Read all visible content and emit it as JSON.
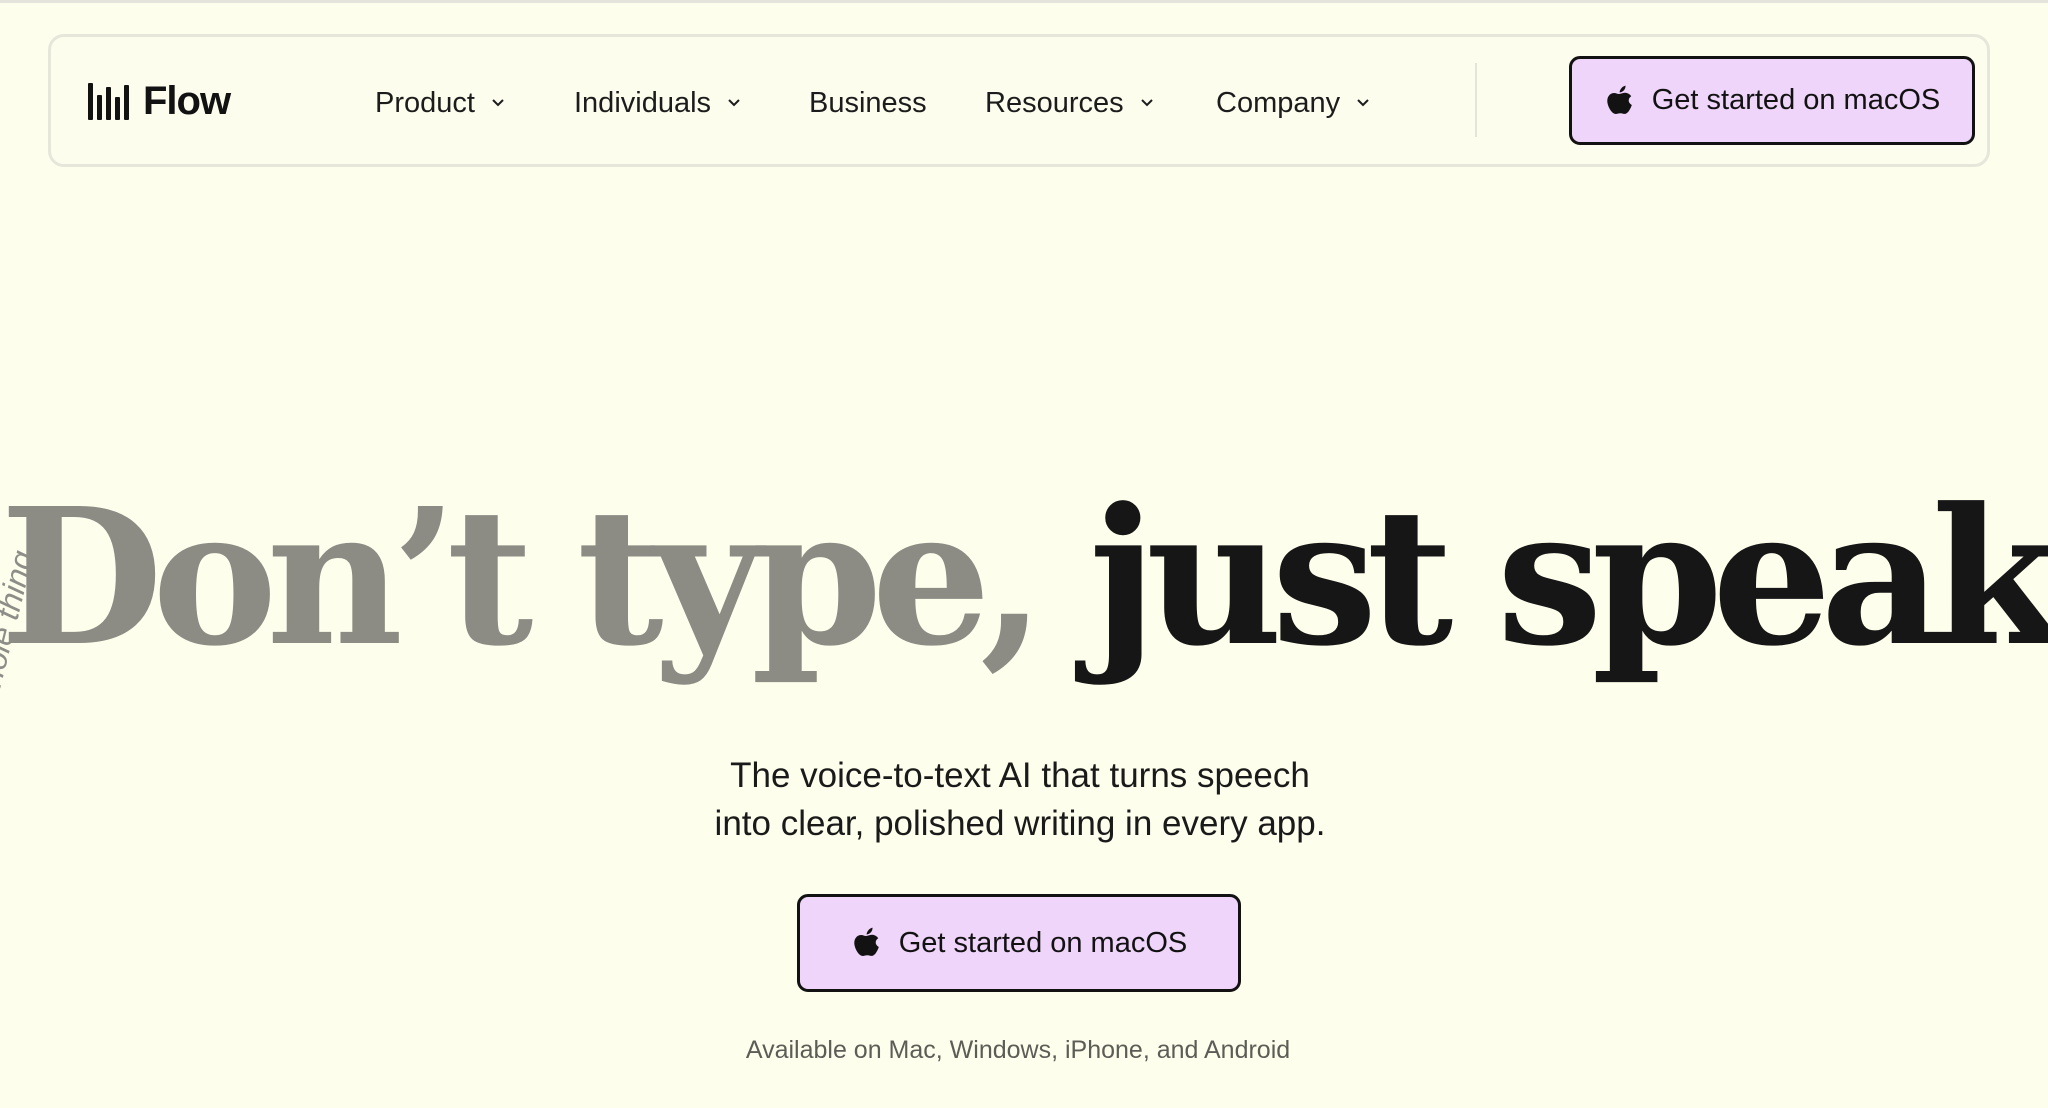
{
  "brand": {
    "name": "Flow",
    "icon": "waveform-bars-icon"
  },
  "nav": {
    "items": [
      {
        "label": "Product",
        "has_dropdown": true
      },
      {
        "label": "Individuals",
        "has_dropdown": true
      },
      {
        "label": "Business",
        "has_dropdown": false
      },
      {
        "label": "Resources",
        "has_dropdown": true
      },
      {
        "label": "Company",
        "has_dropdown": true
      }
    ],
    "cta_label": "Get started on macOS"
  },
  "hero": {
    "headline_part1": "Don’t type, ",
    "headline_part2": "just speak",
    "subtitle_line1": "The voice-to-text AI that turns speech",
    "subtitle_line2": "into clear, polished writing in every app.",
    "cta_label": "Get started on macOS",
    "availability": "Available on Mac, Windows, iPhone, and Android",
    "side_text": "e whole thing"
  },
  "colors": {
    "background": "#fefeec",
    "cta_fill": "#efd5f9",
    "cta_border": "#121212",
    "headline_grey": "#8c8b84",
    "headline_dark": "#161616"
  }
}
